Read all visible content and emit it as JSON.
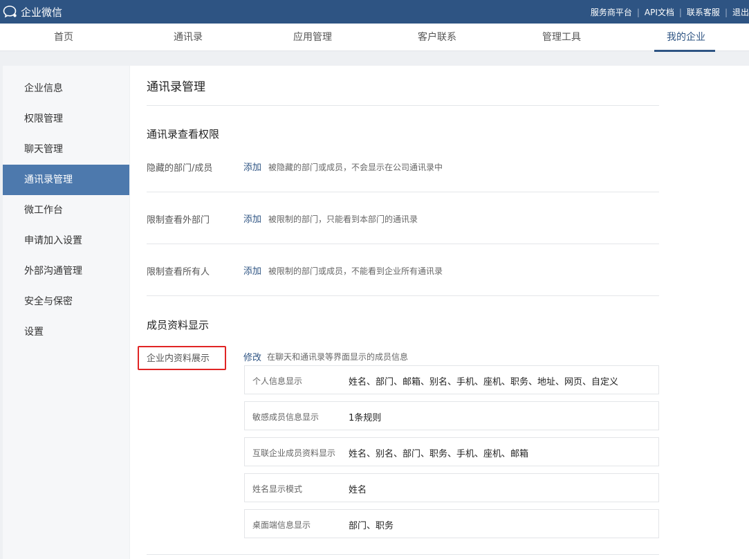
{
  "app": {
    "title": "企业微信",
    "brand_color": "#2e5483",
    "accent_color": "#4d79ad",
    "highlight_color": "#e02424"
  },
  "top_links": [
    {
      "label": "服务商平台"
    },
    {
      "label": "API文档"
    },
    {
      "label": "联系客服"
    },
    {
      "label": "退出"
    }
  ],
  "nav": {
    "items": [
      {
        "label": "首页"
      },
      {
        "label": "通讯录"
      },
      {
        "label": "应用管理"
      },
      {
        "label": "客户联系"
      },
      {
        "label": "管理工具"
      },
      {
        "label": "我的企业",
        "active": true
      }
    ]
  },
  "sidebar": {
    "items": [
      {
        "label": "企业信息"
      },
      {
        "label": "权限管理"
      },
      {
        "label": "聊天管理"
      },
      {
        "label": "通讯录管理",
        "active": true
      },
      {
        "label": "微工作台"
      },
      {
        "label": "申请加入设置"
      },
      {
        "label": "外部沟通管理"
      },
      {
        "label": "安全与保密"
      },
      {
        "label": "设置"
      }
    ]
  },
  "main": {
    "title": "通讯录管理",
    "view_permission": {
      "title": "通讯录查看权限",
      "rows": [
        {
          "label": "隐藏的部门/成员",
          "action": "添加",
          "desc": "被隐藏的部门或成员，不会显示在公司通讯录中"
        },
        {
          "label": "限制查看外部门",
          "action": "添加",
          "desc": "被限制的部门，只能看到本部门的通讯录"
        },
        {
          "label": "限制查看所有人",
          "action": "添加",
          "desc": "被限制的部门或成员，不能看到企业所有通讯录"
        }
      ]
    },
    "member_display": {
      "title": "成员资料显示",
      "profile_label": "企业内资料展示",
      "modify_label": "修改",
      "modify_desc": "在聊天和通讯录等界面显示的成员信息",
      "boxes": [
        {
          "label": "个人信息显示",
          "value": "姓名、部门、邮箱、别名、手机、座机、职务、地址、网页、自定义"
        },
        {
          "label": "敏感成员信息显示",
          "value": "1条规则"
        },
        {
          "label": "互联企业成员资料显示",
          "value": "姓名、别名、部门、职务、手机、座机、邮箱"
        },
        {
          "label": "姓名显示模式",
          "value": "姓名"
        },
        {
          "label": "桌面端信息显示",
          "value": "部门、职务"
        }
      ]
    }
  }
}
